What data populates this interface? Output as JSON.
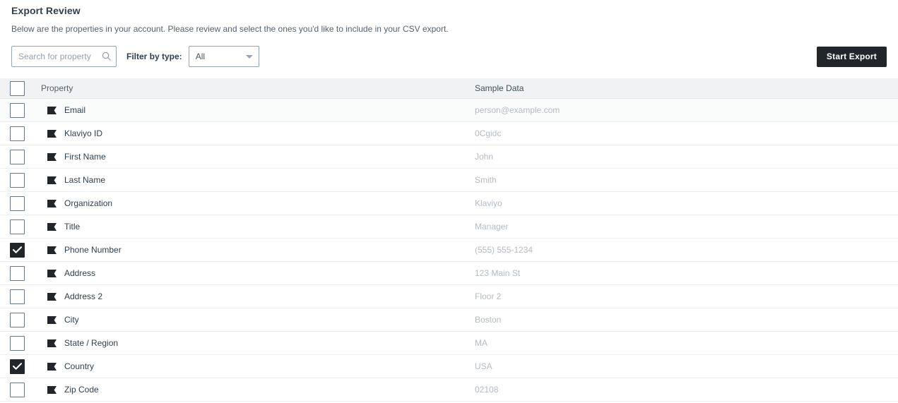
{
  "header": {
    "title": "Export Review",
    "subtitle": "Below are the properties in your account. Please review and select the ones you'd like to include in your CSV export."
  },
  "toolbar": {
    "search_placeholder": "Search for property",
    "search_value": "",
    "search_icon": "search-icon",
    "filter_label": "Filter by type:",
    "filter_selected": "All",
    "filter_options": [
      "All"
    ],
    "filter_caret_icon": "chevron-down-icon",
    "start_export_label": "Start Export",
    "start_export_color": "#22262a"
  },
  "table": {
    "columns": {
      "select_all_checked": false,
      "property": "Property",
      "sample_data": "Sample Data"
    },
    "row_icon": "tag-icon",
    "rows": [
      {
        "checked": false,
        "property": "Email",
        "sample": "person@example.com"
      },
      {
        "checked": false,
        "property": "Klaviyo ID",
        "sample": "0Cgidc"
      },
      {
        "checked": false,
        "property": "First Name",
        "sample": "John"
      },
      {
        "checked": false,
        "property": "Last Name",
        "sample": "Smith"
      },
      {
        "checked": false,
        "property": "Organization",
        "sample": "Klaviyo"
      },
      {
        "checked": false,
        "property": "Title",
        "sample": "Manager"
      },
      {
        "checked": true,
        "property": "Phone Number",
        "sample": "(555) 555-1234"
      },
      {
        "checked": false,
        "property": "Address",
        "sample": "123 Main St"
      },
      {
        "checked": false,
        "property": "Address 2",
        "sample": "Floor 2"
      },
      {
        "checked": false,
        "property": "City",
        "sample": "Boston"
      },
      {
        "checked": false,
        "property": "State / Region",
        "sample": "MA"
      },
      {
        "checked": true,
        "property": "Country",
        "sample": "USA"
      },
      {
        "checked": false,
        "property": "Zip Code",
        "sample": "02108"
      }
    ]
  }
}
